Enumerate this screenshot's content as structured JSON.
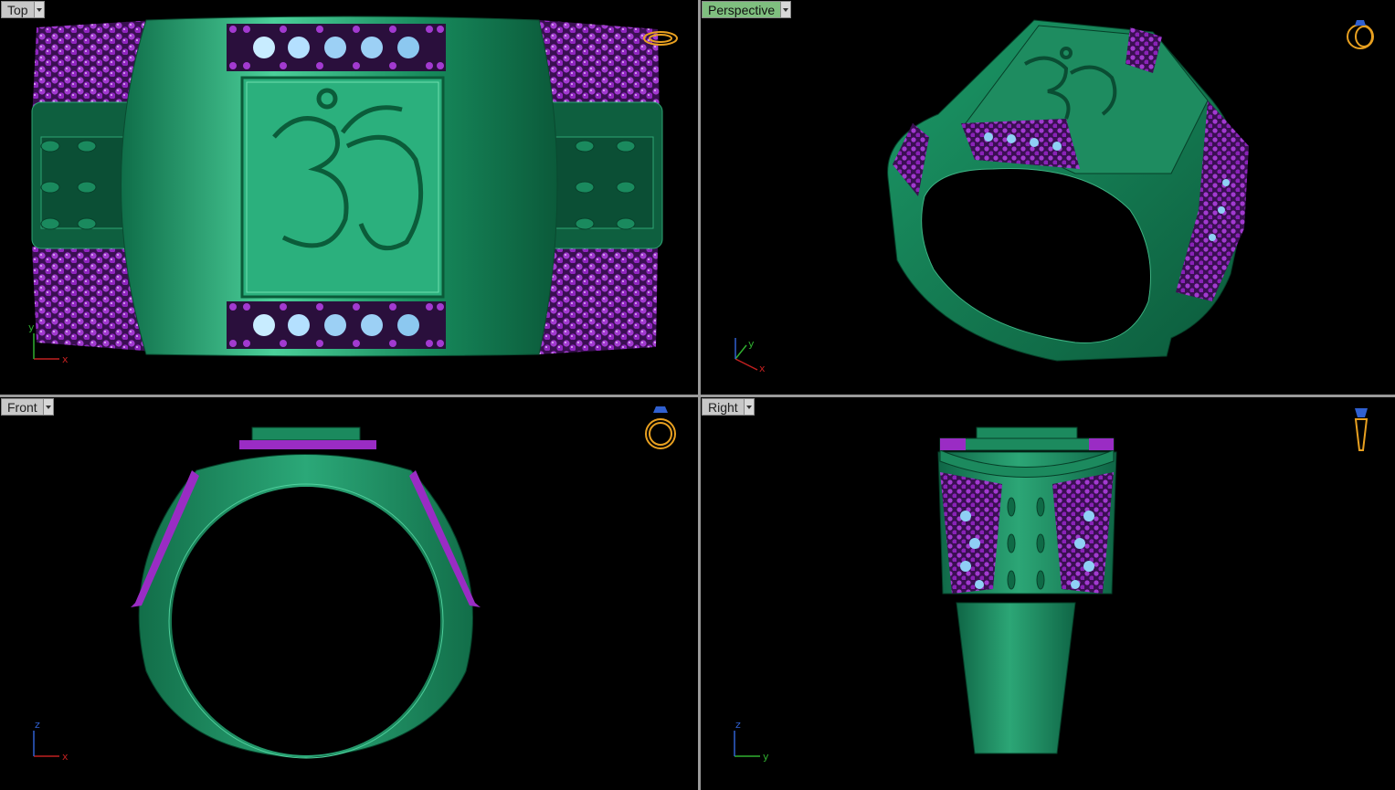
{
  "viewports": {
    "top": {
      "label": "Top",
      "axes": {
        "h": "x",
        "v": "y"
      }
    },
    "perspective": {
      "label": "Perspective",
      "axes": {
        "h": "x",
        "v": "y"
      }
    },
    "front": {
      "label": "Front",
      "axes": {
        "h": "x",
        "v": "z"
      }
    },
    "right": {
      "label": "Right",
      "axes": {
        "h": "y",
        "v": "z"
      }
    }
  },
  "colors": {
    "ring_green": "#1e8a60",
    "gem_purple": "#9a2cc4",
    "gem_blue": "#8fd0f5",
    "widget_gold": "#e8a020",
    "axis_red": "#c02020",
    "axis_green": "#30b030",
    "axis_blue": "#3060d0",
    "active_label": "#7fbf7f"
  },
  "icons": [
    "dropdown-arrow-icon",
    "ring-view-widget-icon",
    "axis-triad-icon"
  ]
}
